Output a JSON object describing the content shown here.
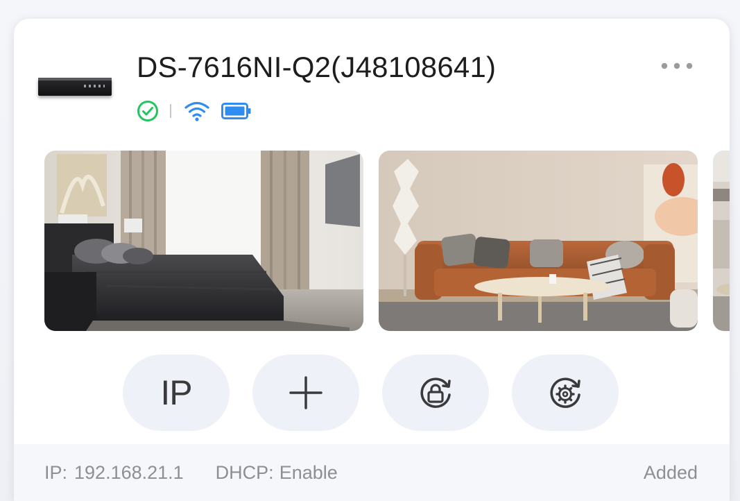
{
  "device": {
    "name": "DS-7616NI-Q2(J48108641)",
    "status_icons": [
      "check-circle-icon",
      "wifi-icon",
      "battery-icon"
    ]
  },
  "colors": {
    "online": "#22c55e",
    "accent": "#2f8cf0",
    "muted": "#8e8e93",
    "button_bg": "#eef1f7"
  },
  "actions": {
    "ip_label": "IP",
    "add_icon": "plus-icon",
    "lock_icon": "lock-refresh-icon",
    "settings_icon": "gear-refresh-icon"
  },
  "footer": {
    "ip_label": "IP:",
    "ip_value": "192.168.21.1",
    "dhcp_label": "DHCP:",
    "dhcp_value": "Enable",
    "status": "Added"
  }
}
